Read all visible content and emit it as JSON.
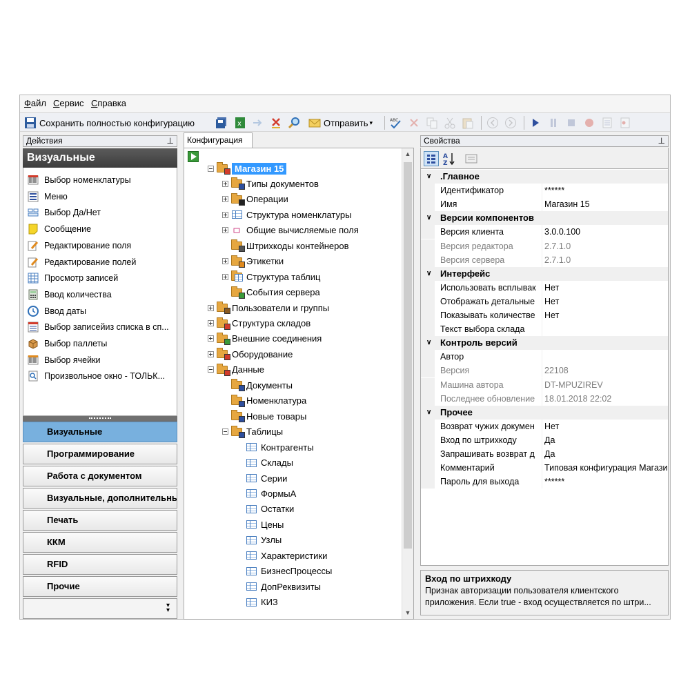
{
  "menu": [
    {
      "accel": "Ф",
      "rest": "айл"
    },
    {
      "accel": "С",
      "rest": "ервис"
    },
    {
      "accel": "С",
      "rest": "правка"
    }
  ],
  "toolbar": {
    "save_full_label": "Сохранить полностью конфигурацию",
    "send_label": "Отправить"
  },
  "left": {
    "header": "Действия",
    "title": "Визуальные",
    "actions": [
      {
        "label": "Выбор номенклатуры",
        "icon": "barcode-list-icon"
      },
      {
        "label": "Меню",
        "icon": "menu-list-icon"
      },
      {
        "label": "Выбор Да/Нет",
        "icon": "yes-no-icon"
      },
      {
        "label": "Сообщение",
        "icon": "message-note-icon"
      },
      {
        "label": "Редактирование поля",
        "icon": "edit-field-icon"
      },
      {
        "label": "Редактирование полей",
        "icon": "edit-fields-icon"
      },
      {
        "label": "Просмотр записей",
        "icon": "records-table-icon"
      },
      {
        "label": "Ввод количества",
        "icon": "calculator-icon"
      },
      {
        "label": "Ввод даты",
        "icon": "date-clock-icon"
      },
      {
        "label": "Выбор записейиз списка в сп...",
        "icon": "list-select-icon"
      },
      {
        "label": "Выбор паллеты",
        "icon": "pallet-box-icon"
      },
      {
        "label": "Выбор ячейки",
        "icon": "cell-select-icon"
      },
      {
        "label": "Произвольное окно - ТОЛЬК...",
        "icon": "custom-window-icon"
      }
    ],
    "categories": [
      "Визуальные",
      "Программирование",
      "Работа с документом",
      "Визуальные, дополнительные",
      "Печать",
      "ККМ",
      "RFID",
      "Прочие"
    ],
    "active_category": 0
  },
  "middle": {
    "tab": "Конфигурация",
    "tree": [
      {
        "label": "Магазин 15",
        "level": 0,
        "exp": "minus",
        "selected": true,
        "icon": "store-folder-icon"
      },
      {
        "label": "Типы документов",
        "level": 1,
        "exp": "plus",
        "icon": "doc-types-folder-icon"
      },
      {
        "label": "Операции",
        "level": 1,
        "exp": "plus",
        "icon": "operations-folder-icon"
      },
      {
        "label": "Структура номенклатуры",
        "level": 1,
        "exp": "plus",
        "icon": "table-structure-icon"
      },
      {
        "label": "Общие вычисляемые поля",
        "level": 1,
        "exp": "plus",
        "icon": "computed-fields-icon"
      },
      {
        "label": "Штрихкоды контейнеров",
        "level": 1,
        "exp": "none",
        "icon": "barcode-folder-icon"
      },
      {
        "label": "Этикетки",
        "level": 1,
        "exp": "plus",
        "icon": "labels-folder-icon"
      },
      {
        "label": "Структура таблиц",
        "level": 1,
        "exp": "plus",
        "icon": "tables-structure-icon"
      },
      {
        "label": "События сервера",
        "level": 1,
        "exp": "none",
        "icon": "server-events-icon"
      },
      {
        "label": "Пользователи и группы",
        "level": 0,
        "exp": "plus",
        "icon": "users-folder-icon"
      },
      {
        "label": "Структура складов",
        "level": 0,
        "exp": "plus",
        "icon": "warehouse-folder-icon"
      },
      {
        "label": "Внешние соединения",
        "level": 0,
        "exp": "plus",
        "icon": "connections-folder-icon"
      },
      {
        "label": "Оборудование",
        "level": 0,
        "exp": "plus",
        "icon": "equipment-folder-icon"
      },
      {
        "label": "Данные",
        "level": 0,
        "exp": "minus",
        "icon": "data-folder-icon"
      },
      {
        "label": "Документы",
        "level": 1,
        "exp": "none",
        "icon": "documents-folder-icon"
      },
      {
        "label": "Номенклатура",
        "level": 1,
        "exp": "none",
        "icon": "nomenclature-folder-icon"
      },
      {
        "label": "Новые товары",
        "level": 1,
        "exp": "none",
        "icon": "new-goods-folder-icon"
      },
      {
        "label": "Таблицы",
        "level": 1,
        "exp": "minus",
        "icon": "tables-folder-icon"
      },
      {
        "label": "Контрагенты",
        "level": 2,
        "exp": "none",
        "icon": "table-icon"
      },
      {
        "label": "Склады",
        "level": 2,
        "exp": "none",
        "icon": "table-icon"
      },
      {
        "label": "Серии",
        "level": 2,
        "exp": "none",
        "icon": "table-icon"
      },
      {
        "label": "ФормыА",
        "level": 2,
        "exp": "none",
        "icon": "table-icon"
      },
      {
        "label": "Остатки",
        "level": 2,
        "exp": "none",
        "icon": "table-icon"
      },
      {
        "label": "Цены",
        "level": 2,
        "exp": "none",
        "icon": "table-icon"
      },
      {
        "label": "Узлы",
        "level": 2,
        "exp": "none",
        "icon": "table-icon"
      },
      {
        "label": "Характеристики",
        "level": 2,
        "exp": "none",
        "icon": "table-icon"
      },
      {
        "label": "БизнесПроцессы",
        "level": 2,
        "exp": "none",
        "icon": "table-icon"
      },
      {
        "label": "ДопРеквизиты",
        "level": 2,
        "exp": "none",
        "icon": "table-icon"
      },
      {
        "label": "КИЗ",
        "level": 2,
        "exp": "none",
        "icon": "table-icon"
      }
    ]
  },
  "right": {
    "header": "Свойства",
    "rows": [
      {
        "type": "cat",
        "label": ".Главное"
      },
      {
        "type": "prop",
        "name": "Идентификатор",
        "value": "******"
      },
      {
        "type": "prop",
        "name": "Имя",
        "value": "Магазин 15"
      },
      {
        "type": "cat",
        "label": "Версии компонентов"
      },
      {
        "type": "prop",
        "name": "Версия клиента",
        "value": "3.0.0.100"
      },
      {
        "type": "prop",
        "name": "Версия редактора",
        "value": "2.7.1.0",
        "readonly": true
      },
      {
        "type": "prop",
        "name": "Версия сервера",
        "value": "2.7.1.0",
        "readonly": true
      },
      {
        "type": "cat",
        "label": "Интерфейс"
      },
      {
        "type": "prop",
        "name": "Использовать всплывак",
        "value": "Нет"
      },
      {
        "type": "prop",
        "name": "Отображать детальные",
        "value": "Нет"
      },
      {
        "type": "prop",
        "name": "Показывать количестве",
        "value": "Нет"
      },
      {
        "type": "prop",
        "name": "Текст выбора склада",
        "value": ""
      },
      {
        "type": "cat",
        "label": "Контроль версий"
      },
      {
        "type": "prop",
        "name": "Автор",
        "value": ""
      },
      {
        "type": "prop",
        "name": "Версия",
        "value": "22108",
        "readonly": true
      },
      {
        "type": "prop",
        "name": "Машина автора",
        "value": "DT-MPUZIREV",
        "readonly": true
      },
      {
        "type": "prop",
        "name": "Последнее обновление",
        "value": "18.01.2018 22:02",
        "readonly": true
      },
      {
        "type": "cat",
        "label": "Прочее"
      },
      {
        "type": "prop",
        "name": "Возврат чужих докумен",
        "value": "Нет"
      },
      {
        "type": "prop",
        "name": "Вход по штрихкоду",
        "value": "Да"
      },
      {
        "type": "prop",
        "name": "Запрашивать возврат д",
        "value": "Да"
      },
      {
        "type": "prop",
        "name": "Комментарий",
        "value": "Типовая конфигурация Магази"
      },
      {
        "type": "prop",
        "name": "Пароль для выхода",
        "value": "******"
      }
    ],
    "description": {
      "title": "Вход по штрихкоду",
      "text": "Признак авторизации пользователя клиентского приложения. Если true - вход осуществляется по штри..."
    }
  },
  "colors": {
    "selection": "#3399ff",
    "active_category": "#78b0de",
    "folder": "#e6a740"
  }
}
